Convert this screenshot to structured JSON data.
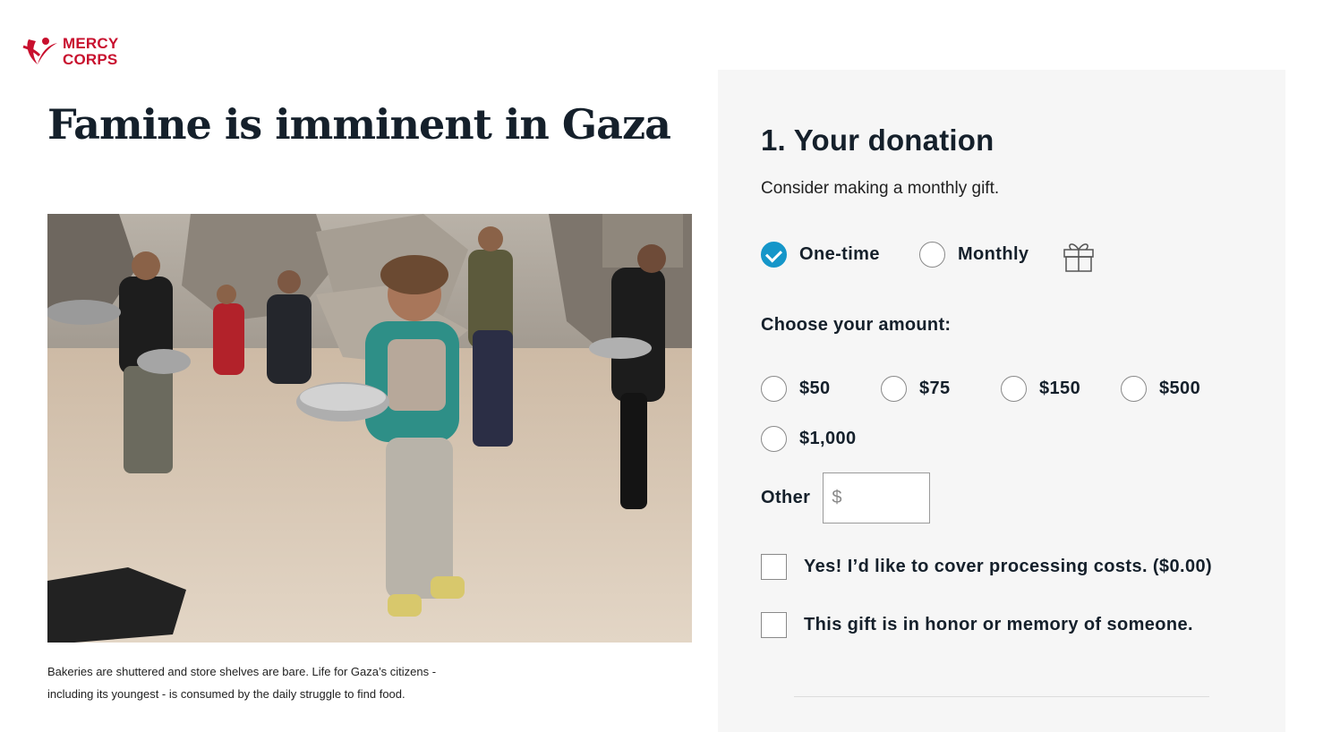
{
  "brand": {
    "name_line1": "MERCY",
    "name_line2": "CORPS",
    "color": "#c8102e"
  },
  "headline": "Famine is imminent in Gaza",
  "photo": {
    "icon": "photo-children-holding-pots"
  },
  "caption": "Bakeries are shuttered and store shelves are bare. Life for Gaza’s citizens - including its youngest - is consumed by the daily struggle to find food.",
  "donation": {
    "title": "1. Your donation",
    "subtitle": "Consider making a monthly gift.",
    "frequency": {
      "options": [
        {
          "label": "One-time",
          "selected": true
        },
        {
          "label": "Monthly",
          "selected": false
        }
      ],
      "gift_icon": "gift-icon"
    },
    "amount_heading": "Choose your amount:",
    "amounts": [
      "$50",
      "$75",
      "$150",
      "$500",
      "$1,000"
    ],
    "other_label": "Other",
    "other_placeholder": "$",
    "checkboxes": [
      {
        "label": "Yes! I’d like to cover processing costs. ($0.00)",
        "checked": false
      },
      {
        "label": "This gift is in honor or memory of someone.",
        "checked": false
      }
    ],
    "accent_color": "#1596c9"
  }
}
